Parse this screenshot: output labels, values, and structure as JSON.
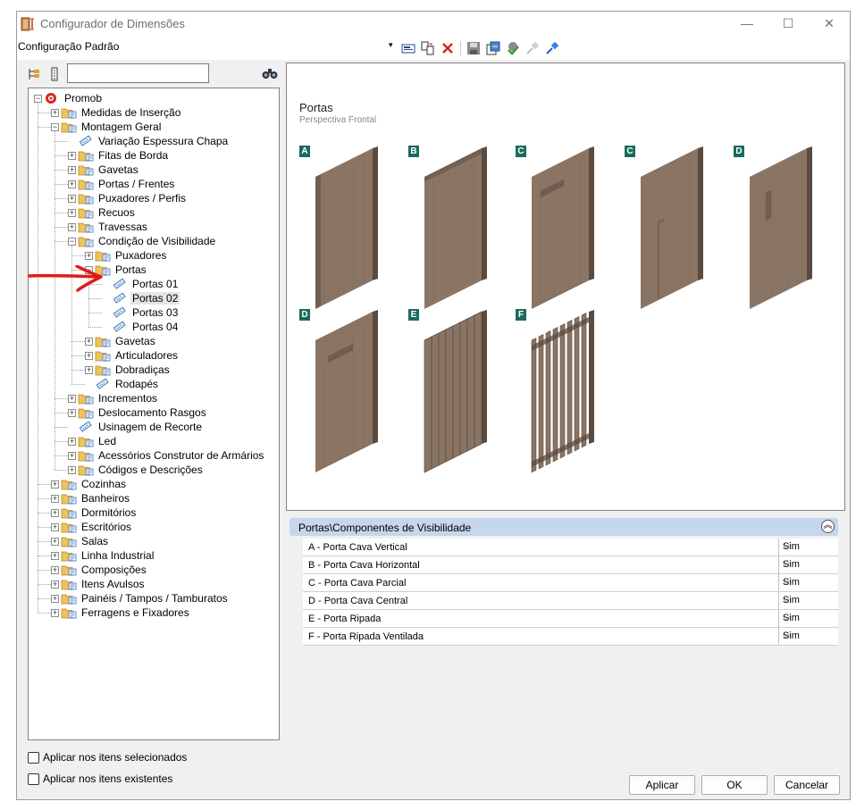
{
  "window": {
    "title": "Configurador de Dimensões",
    "minimize": "—",
    "maximize": "☐",
    "close": "✕"
  },
  "toolbar": {
    "configuration": "Configuração Padrão",
    "dropdown_arrow": "▾",
    "icons": [
      "dimension-edit-icon",
      "copy-icon",
      "delete-icon",
      "save-icon",
      "export-icon",
      "apply-green-icon",
      "pin-disabled-icon",
      "pin-icon"
    ]
  },
  "tree": {
    "search_value": "",
    "nodes": [
      {
        "label": "Promob",
        "level": 0,
        "expander": "-",
        "type": "root"
      },
      {
        "label": "Medidas de Inserção",
        "level": 1,
        "expander": "+",
        "type": "folder"
      },
      {
        "label": "Montagem Geral",
        "level": 1,
        "expander": "-",
        "type": "folder"
      },
      {
        "label": "Variação Espessura Chapa",
        "level": 2,
        "expander": "",
        "type": "item"
      },
      {
        "label": "Fitas de Borda",
        "level": 2,
        "expander": "+",
        "type": "folder"
      },
      {
        "label": "Gavetas",
        "level": 2,
        "expander": "+",
        "type": "folder"
      },
      {
        "label": "Portas / Frentes",
        "level": 2,
        "expander": "+",
        "type": "folder"
      },
      {
        "label": "Puxadores / Perfis",
        "level": 2,
        "expander": "+",
        "type": "folder"
      },
      {
        "label": "Recuos",
        "level": 2,
        "expander": "+",
        "type": "folder"
      },
      {
        "label": "Travessas",
        "level": 2,
        "expander": "+",
        "type": "folder"
      },
      {
        "label": "Condição de Visibilidade",
        "level": 2,
        "expander": "-",
        "type": "folder"
      },
      {
        "label": "Puxadores",
        "level": 3,
        "expander": "+",
        "type": "folder"
      },
      {
        "label": "Portas",
        "level": 3,
        "expander": "-",
        "type": "folder"
      },
      {
        "label": "Portas 01",
        "level": 4,
        "expander": "",
        "type": "item"
      },
      {
        "label": "Portas 02",
        "level": 4,
        "expander": "",
        "type": "item",
        "selected": true
      },
      {
        "label": "Portas 03",
        "level": 4,
        "expander": "",
        "type": "item"
      },
      {
        "label": "Portas 04",
        "level": 4,
        "expander": "",
        "type": "item"
      },
      {
        "label": "Gavetas",
        "level": 3,
        "expander": "+",
        "type": "folder"
      },
      {
        "label": "Articuladores",
        "level": 3,
        "expander": "+",
        "type": "folder"
      },
      {
        "label": "Dobradiças",
        "level": 3,
        "expander": "+",
        "type": "folder"
      },
      {
        "label": "Rodapés",
        "level": 3,
        "expander": "",
        "type": "item"
      },
      {
        "label": "Incrementos",
        "level": 2,
        "expander": "+",
        "type": "folder"
      },
      {
        "label": "Deslocamento Rasgos",
        "level": 2,
        "expander": "+",
        "type": "folder"
      },
      {
        "label": "Usinagem de Recorte",
        "level": 2,
        "expander": "",
        "type": "item"
      },
      {
        "label": "Led",
        "level": 2,
        "expander": "+",
        "type": "folder"
      },
      {
        "label": "Acessórios Construtor de Armários",
        "level": 2,
        "expander": "+",
        "type": "folder"
      },
      {
        "label": "Códigos e Descrições",
        "level": 2,
        "expander": "+",
        "type": "folder"
      },
      {
        "label": "Cozinhas",
        "level": 1,
        "expander": "+",
        "type": "folder"
      },
      {
        "label": "Banheiros",
        "level": 1,
        "expander": "+",
        "type": "folder"
      },
      {
        "label": "Dormitórios",
        "level": 1,
        "expander": "+",
        "type": "folder"
      },
      {
        "label": "Escritórios",
        "level": 1,
        "expander": "+",
        "type": "folder"
      },
      {
        "label": "Salas",
        "level": 1,
        "expander": "+",
        "type": "folder"
      },
      {
        "label": "Linha Industrial",
        "level": 1,
        "expander": "+",
        "type": "folder"
      },
      {
        "label": "Composições",
        "level": 1,
        "expander": "+",
        "type": "folder"
      },
      {
        "label": "Itens Avulsos",
        "level": 1,
        "expander": "+",
        "type": "folder"
      },
      {
        "label": "Painéis / Tampos / Tamburatos",
        "level": 1,
        "expander": "+",
        "type": "folder"
      },
      {
        "label": "Ferragens e Fixadores",
        "level": 1,
        "expander": "+",
        "type": "folder"
      }
    ]
  },
  "preview": {
    "title": "Portas",
    "subtitle": "Perspectiva Frontal",
    "doors": [
      {
        "tag": "A",
        "style": "cava-vertical"
      },
      {
        "tag": "B",
        "style": "cava-horizontal"
      },
      {
        "tag": "C",
        "style": "cava-parcial-top"
      },
      {
        "tag": "C",
        "style": "cava-parcial-mid"
      },
      {
        "tag": "D",
        "style": "cava-central-vertical"
      },
      {
        "tag": "D",
        "style": "cava-central-horizontal"
      },
      {
        "tag": "E",
        "style": "ripada"
      },
      {
        "tag": "F",
        "style": "ripada-ventilada"
      }
    ]
  },
  "properties": {
    "header": "Portas\\Componentes de Visibilidade",
    "collapse_glyph": "︽",
    "rows": [
      {
        "name": "A - Porta Cava Vertical",
        "value": "Sim"
      },
      {
        "name": "B - Porta Cava Horizontal",
        "value": "Sim"
      },
      {
        "name": "C - Porta Cava Parcial",
        "value": "Sim"
      },
      {
        "name": "D - Porta Cava Central",
        "value": "Sim"
      },
      {
        "name": "E - Porta Ripada",
        "value": "Sim"
      },
      {
        "name": "F - Porta Ripada Ventilada",
        "value": "Sim"
      }
    ],
    "chevron": "⌵"
  },
  "options": {
    "apply_selected": "Aplicar nos itens selecionados",
    "apply_existing": "Aplicar nos itens existentes"
  },
  "buttons": {
    "apply": "Aplicar",
    "ok": "OK",
    "cancel": "Cancelar"
  },
  "colors": {
    "wood_light": "#8a7565",
    "wood_dark": "#5b4a3e",
    "tag_green": "#1b6b5d",
    "header_blue": "#c6d6ec",
    "arrow_red": "#e01b1b"
  }
}
